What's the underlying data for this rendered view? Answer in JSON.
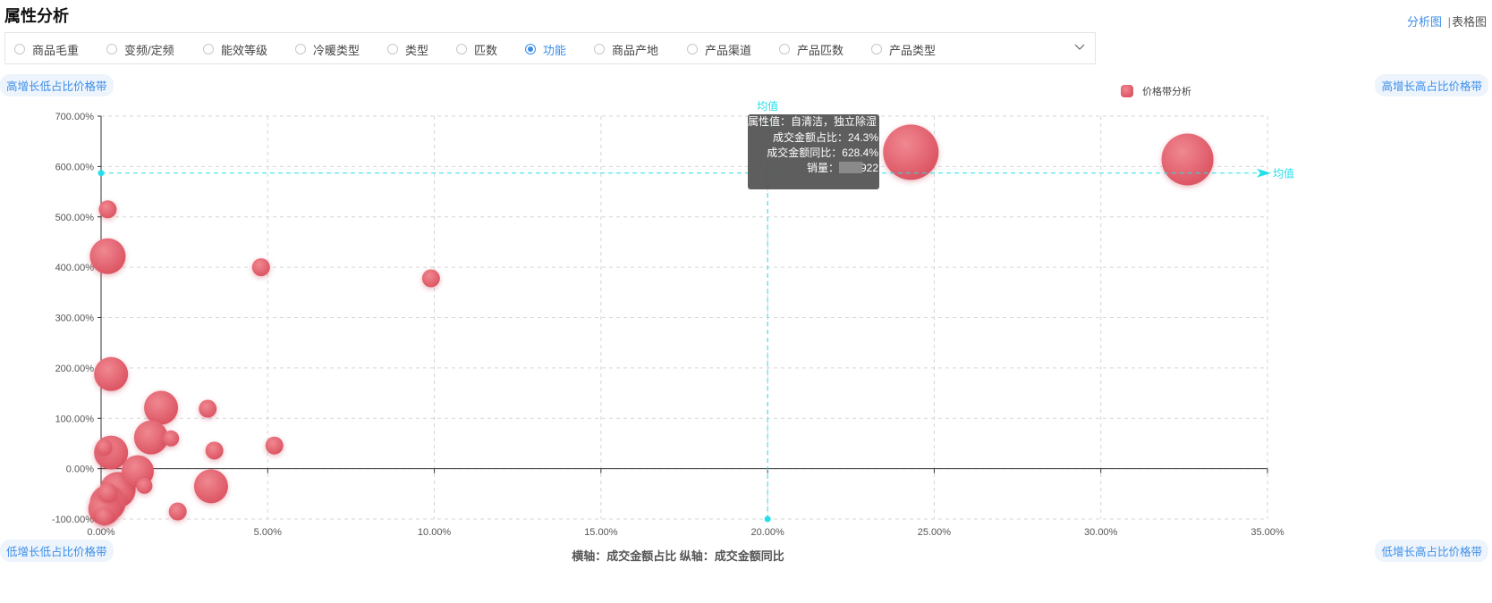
{
  "header": {
    "title": "属性分析",
    "view_analysis": "分析图",
    "view_separator": "|",
    "view_table": "表格图"
  },
  "filters": {
    "options": [
      {
        "label": "商品毛重",
        "selected": false
      },
      {
        "label": "变频/定频",
        "selected": false
      },
      {
        "label": "能效等级",
        "selected": false
      },
      {
        "label": "冷暖类型",
        "selected": false
      },
      {
        "label": "类型",
        "selected": false
      },
      {
        "label": "匹数",
        "selected": false
      },
      {
        "label": "功能",
        "selected": true
      },
      {
        "label": "商品产地",
        "selected": false
      },
      {
        "label": "产品渠道",
        "selected": false
      },
      {
        "label": "产品匹数",
        "selected": false
      },
      {
        "label": "产品类型",
        "selected": false
      }
    ],
    "expand_icon": "chevron-down-icon"
  },
  "quadrants": {
    "top_left": "高增长低占比价格带",
    "top_right": "高增长高占比价格带",
    "bottom_left": "低增长低占比价格带",
    "bottom_right": "低增长高占比价格带"
  },
  "axis_caption": "横轴：成交金额占比  纵轴：成交金额同比",
  "colors": {
    "bubble": "#e0606e",
    "accent": "#3c8ee8",
    "mean_line": "#22e0ea",
    "tooltip_bg": "#555555"
  },
  "chart_data": {
    "type": "scatter",
    "legend": "价格带分析",
    "legend_position": "top-right",
    "mean_label": "均值",
    "x_mean": 20,
    "y_mean": 587,
    "xlim": [
      0,
      35
    ],
    "ylim": [
      -100,
      700
    ],
    "x_ticks": [
      "0.00%",
      "5.00%",
      "10.00%",
      "15.00%",
      "20.00%",
      "25.00%",
      "30.00%",
      "35.00%"
    ],
    "y_ticks": [
      "-100.00%",
      "0.00%",
      "100.00%",
      "200.00%",
      "300.00%",
      "400.00%",
      "500.00%",
      "600.00%",
      "700.00%"
    ],
    "grid": true,
    "points": [
      {
        "x": 24.3,
        "y": 628.4,
        "size": 62
      },
      {
        "x": 32.6,
        "y": 614,
        "size": 58
      },
      {
        "x": 0.2,
        "y": 515,
        "size": 20
      },
      {
        "x": 0.2,
        "y": 422,
        "size": 40
      },
      {
        "x": 4.8,
        "y": 400,
        "size": 20
      },
      {
        "x": 9.9,
        "y": 378,
        "size": 20
      },
      {
        "x": 0.3,
        "y": 188,
        "size": 38
      },
      {
        "x": 1.8,
        "y": 121,
        "size": 38
      },
      {
        "x": 3.2,
        "y": 119,
        "size": 20
      },
      {
        "x": 1.5,
        "y": 62,
        "size": 38
      },
      {
        "x": 2.1,
        "y": 60,
        "size": 18
      },
      {
        "x": 5.2,
        "y": 46,
        "size": 20
      },
      {
        "x": 3.4,
        "y": 36,
        "size": 20
      },
      {
        "x": 0.3,
        "y": 32,
        "size": 38
      },
      {
        "x": 0.1,
        "y": 42,
        "size": 18
      },
      {
        "x": 1.1,
        "y": -5,
        "size": 36
      },
      {
        "x": 1.3,
        "y": -34,
        "size": 18
      },
      {
        "x": 3.3,
        "y": -35,
        "size": 38
      },
      {
        "x": 0.5,
        "y": -42,
        "size": 40
      },
      {
        "x": 0.2,
        "y": -48,
        "size": 22
      },
      {
        "x": 0.2,
        "y": -68,
        "size": 40
      },
      {
        "x": 0.1,
        "y": -80,
        "size": 36
      },
      {
        "x": 2.3,
        "y": -85,
        "size": 20
      },
      {
        "x": 0.1,
        "y": -95,
        "size": 20
      }
    ],
    "tooltip": {
      "attribute_label": "属性值：",
      "attribute_value": "自清洁，独立除湿",
      "share_label": "成交金额占比：",
      "share_value": "24.3%",
      "yoy_label": "成交金额同比：",
      "yoy_value": "628.4%",
      "sales_label": "销量：",
      "sales_value": "922"
    }
  }
}
